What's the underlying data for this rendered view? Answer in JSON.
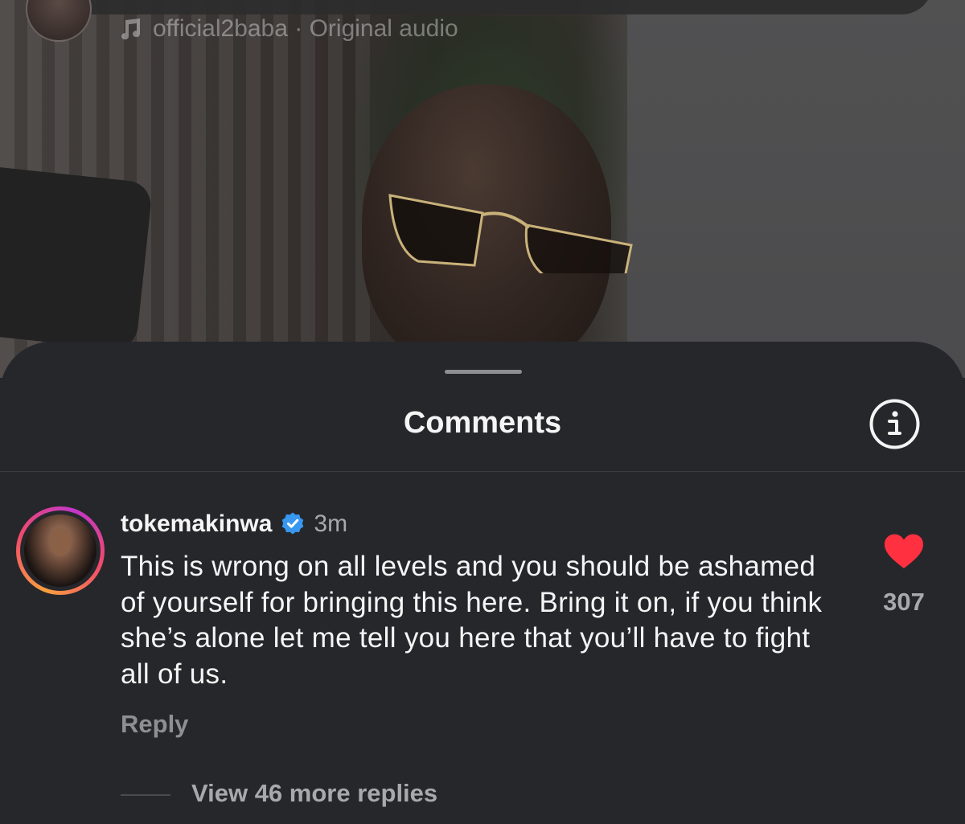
{
  "header": {
    "audio_label": "official2baba · Original audio"
  },
  "sheet": {
    "title": "Comments"
  },
  "comment": {
    "username": "tokemakinwa",
    "time": "3m",
    "text": "This is wrong on all levels and you should be ashamed of yourself for bringing this here. Bring it on, if you think she’s alone let me tell you here that you’ll have to fight all of us.",
    "reply_label": "Reply",
    "like_count": "307",
    "view_replies_label": "View 46 more replies"
  },
  "icons": {
    "music": "music-note-icon",
    "info": "info-icon",
    "verified": "verified-badge-icon",
    "like": "heart-icon"
  },
  "colors": {
    "background": "#26272b",
    "text_primary": "#f5f5f5",
    "text_secondary": "#a8a9ad",
    "verified_blue": "#3897f0",
    "like_red": "#ff3040"
  }
}
